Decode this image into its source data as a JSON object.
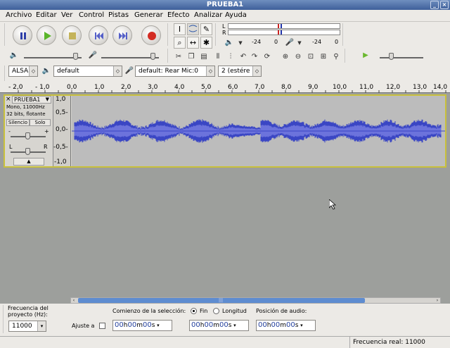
{
  "window": {
    "title": "PRUEBA1",
    "controls": [
      "×",
      "□"
    ]
  },
  "menu": [
    "Archivo",
    "Editar",
    "Ver",
    "Control",
    "Pistas",
    "Generar",
    "Efecto",
    "Analizar",
    "Ayuda"
  ],
  "meters": {
    "rec_label": "L",
    "play_label": "R",
    "db_left_1": "-24",
    "db_left_2": "0",
    "db_right_1": "-24",
    "db_right_2": "0"
  },
  "devices": {
    "host": "ALSA",
    "output": "default",
    "input": "default: Rear Mic:0",
    "channels": "2 (estére"
  },
  "ruler_ticks": [
    "- 2,0",
    "- 1,0",
    "0,0",
    "1,0",
    "2,0",
    "3,0",
    "4,0",
    "5,0",
    "6,0",
    "7,0",
    "8,0",
    "9,0",
    "10,0",
    "11,0",
    "12,0",
    "13,0",
    "14,0"
  ],
  "track": {
    "name": "PRUEBA1",
    "close": "×",
    "info1": "Mono, 11000Hz",
    "info2": "32 bits, flotante",
    "mute": "Silencio",
    "solo": "Solo",
    "gain_minus": "-",
    "gain_plus": "+",
    "pan_left": "L",
    "pan_right": "R",
    "collapse": "▲",
    "vruler": [
      "1,0",
      "0,5-",
      "0,0-",
      "-0,5-",
      "-1,0"
    ]
  },
  "bottom": {
    "rate_label": "Frecuencia del proyecto (Hz):",
    "rate_value": "11000",
    "snap_label": "Ajuste a",
    "selection_start_label": "Comienzo de la selección:",
    "end_label": "Fin",
    "length_label": "Longitud",
    "audio_pos_label": "Posición de audio:",
    "time1": [
      "00",
      "00",
      "00"
    ],
    "time2": [
      "00",
      "00",
      "00"
    ],
    "time3": [
      "00",
      "00",
      "00"
    ],
    "units": [
      "h",
      "m",
      "s"
    ]
  },
  "status": {
    "actual_rate": "Frecuencia real: 11000"
  },
  "colors": {
    "waveform": "#3a46c4",
    "waveform_rms": "#6c73dc",
    "selection_border": "#c8c03c",
    "canvas": "#9d9f9c"
  }
}
